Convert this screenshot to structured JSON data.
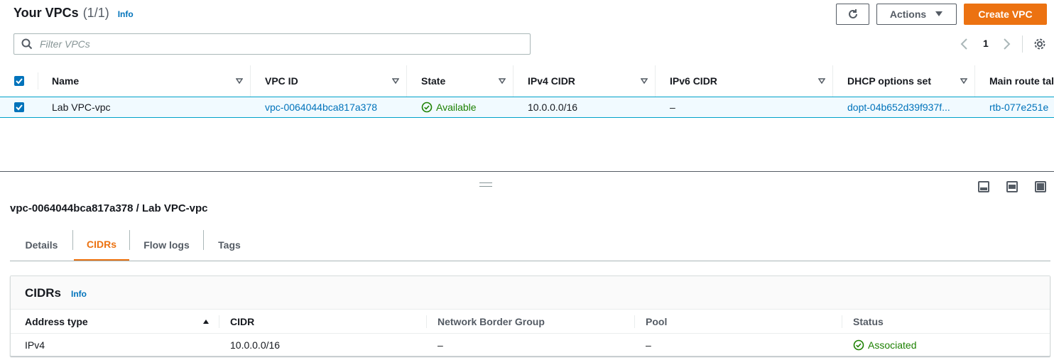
{
  "header": {
    "title": "Your VPCs",
    "count": "(1/1)",
    "info": "Info",
    "actions_label": "Actions",
    "create_label": "Create VPC"
  },
  "search": {
    "placeholder": "Filter VPCs"
  },
  "pagination": {
    "page": "1"
  },
  "table": {
    "columns": [
      "Name",
      "VPC ID",
      "State",
      "IPv4 CIDR",
      "IPv6 CIDR",
      "DHCP options set",
      "Main route tal"
    ],
    "rows": [
      {
        "name": "Lab VPC-vpc",
        "vpc_id": "vpc-0064044bca817a378",
        "state": "Available",
        "ipv4": "10.0.0.0/16",
        "ipv6": "–",
        "dhcp": "dopt-04b652d39f937f...",
        "route": "rtb-077e251e"
      }
    ]
  },
  "details": {
    "heading": "vpc-0064044bca817a378 / Lab VPC-vpc",
    "tabs": [
      "Details",
      "CIDRs",
      "Flow logs",
      "Tags"
    ],
    "active_tab": "CIDRs"
  },
  "cidrs": {
    "title": "CIDRs",
    "info": "Info",
    "columns": [
      "Address type",
      "CIDR",
      "Network Border Group",
      "Pool",
      "Status"
    ],
    "rows": [
      {
        "address_type": "IPv4",
        "cidr": "10.0.0.0/16",
        "nbg": "–",
        "pool": "–",
        "status": "Associated"
      }
    ]
  },
  "colors": {
    "accent": "#ec7211",
    "link": "#0073bb",
    "success": "#1d8102",
    "selected_row": "#f1faff"
  }
}
